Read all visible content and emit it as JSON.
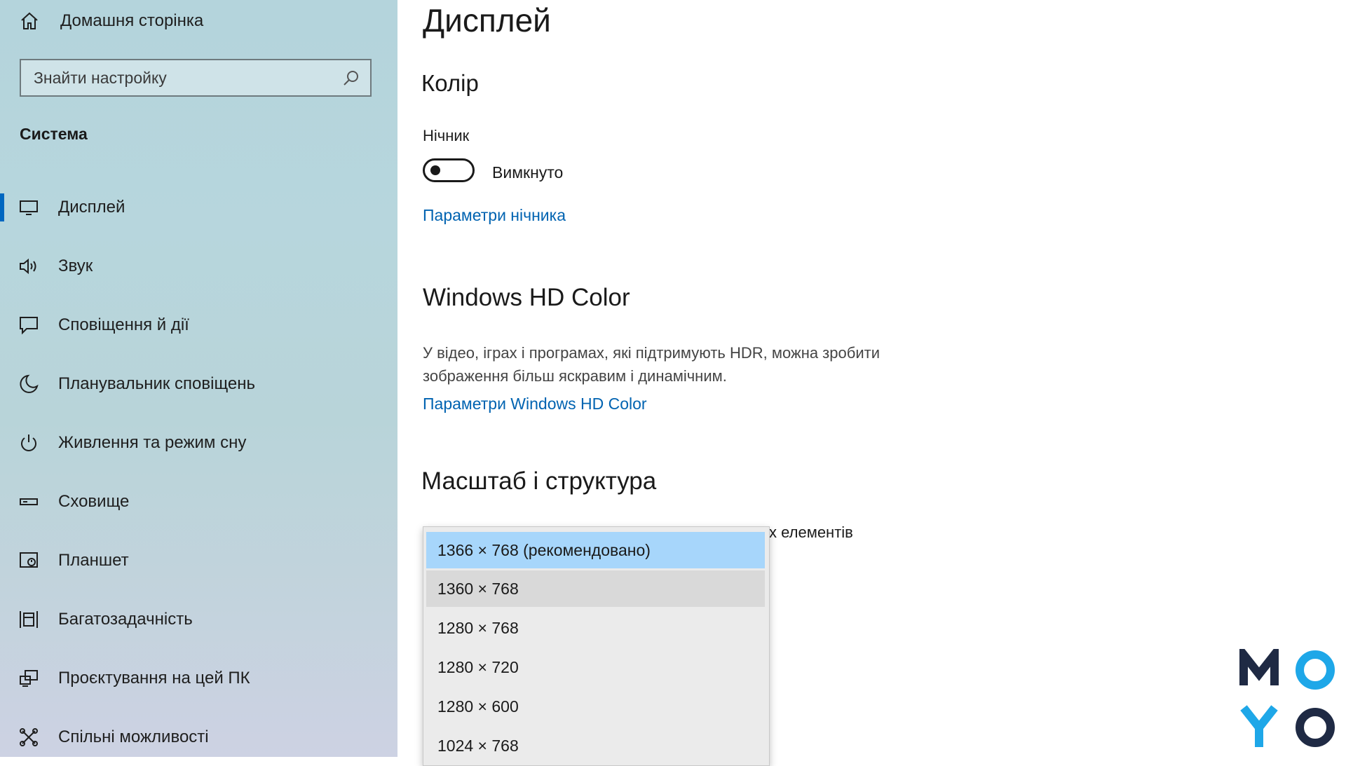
{
  "sidebar": {
    "home_label": "Домашня сторінка",
    "search_placeholder": "Знайти настройку",
    "section": "Система",
    "items": [
      {
        "label": "Дисплей",
        "icon": "monitor-icon"
      },
      {
        "label": "Звук",
        "icon": "speaker-icon"
      },
      {
        "label": "Сповіщення й дії",
        "icon": "notification-icon"
      },
      {
        "label": "Планувальник сповіщень",
        "icon": "moon-icon"
      },
      {
        "label": "Живлення та режим сну",
        "icon": "power-icon"
      },
      {
        "label": "Сховище",
        "icon": "storage-icon"
      },
      {
        "label": "Планшет",
        "icon": "tablet-icon"
      },
      {
        "label": "Багатозадачність",
        "icon": "multitasking-icon"
      },
      {
        "label": "Проєктування на цей ПК",
        "icon": "projecting-icon"
      },
      {
        "label": "Спільні можливості",
        "icon": "shared-experiences-icon"
      }
    ],
    "active_index": 0
  },
  "main": {
    "title": "Дисплей",
    "color_heading": "Колір",
    "night_light_label": "Нічник",
    "night_light_state": "Вимкнуто",
    "night_light_on": false,
    "night_light_link": "Параметри нічника",
    "hdr_heading": "Windows HD Color",
    "hdr_description": "У відео, іграх і програмах, які підтримують HDR, можна зробити зображення більш яскравим і динамічним.",
    "hdr_link": "Параметри Windows HD Color",
    "scale_heading": "Масштаб і структура",
    "partial_text": "х елементів"
  },
  "resolution_dropdown": {
    "options": [
      "1366 × 768 (рекомендовано)",
      "1360 × 768",
      "1280 × 768",
      "1280 × 720",
      "1280 × 600",
      "1024 × 768"
    ],
    "selected_index": 0,
    "hover_index": 1
  },
  "logo": {
    "letters": [
      "M",
      "O",
      "Y",
      "O"
    ],
    "dark_color": "#1f2a44",
    "accent_color": "#1ea7e8"
  },
  "colors": {
    "link": "#0063b1",
    "accent": "#0067c0",
    "selected_option": "#a7d6fb"
  }
}
